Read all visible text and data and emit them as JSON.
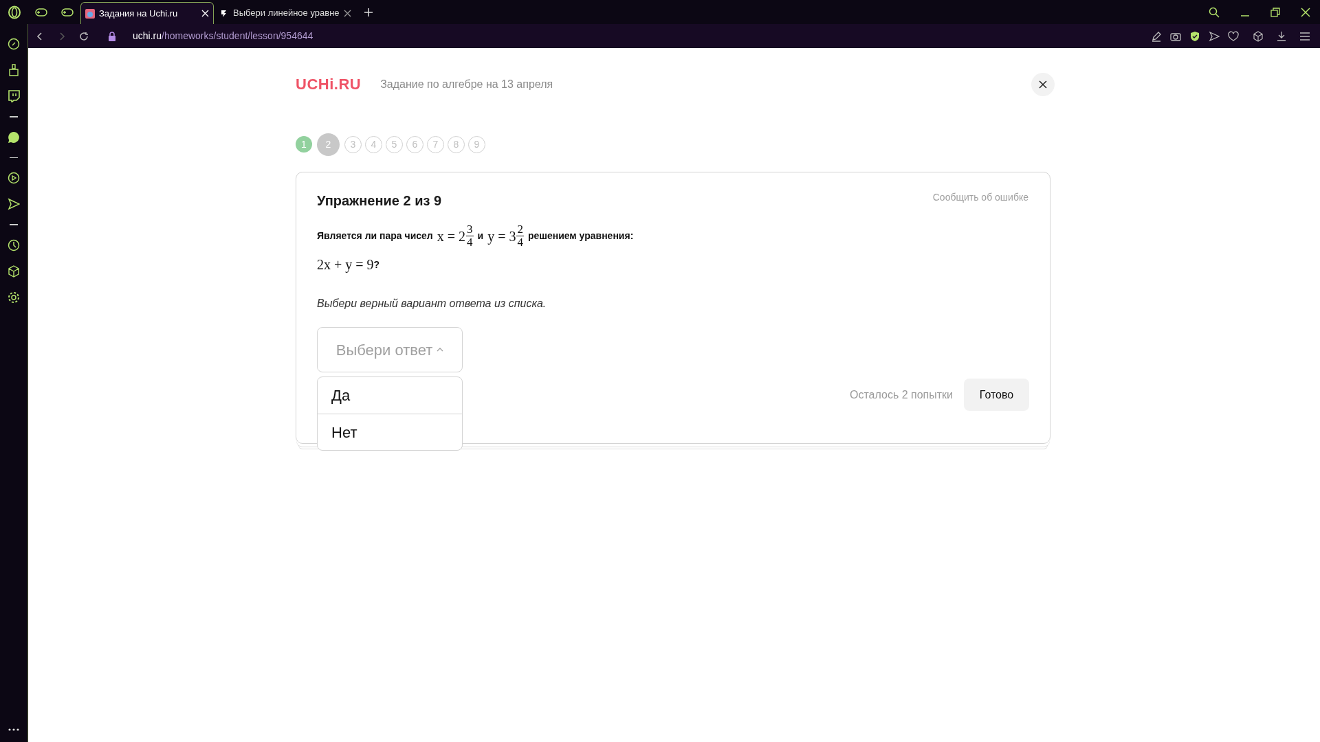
{
  "browser": {
    "tabs": [
      {
        "label": "Задания на Uchi.ru",
        "selected": true
      },
      {
        "label": "Выбери линейное уравне",
        "selected": false
      }
    ],
    "address": {
      "host": "uchi.ru",
      "path": "/homeworks/student/lesson/954644"
    }
  },
  "header": {
    "logo": "UCHi.RU",
    "title": "Задание по алгебре на 13 апреля"
  },
  "steps": [
    {
      "label": "1",
      "completed": true,
      "selected": false
    },
    {
      "label": "2",
      "completed": false,
      "selected": true
    },
    {
      "label": "3",
      "completed": false,
      "selected": false
    },
    {
      "label": "4",
      "completed": false,
      "selected": false
    },
    {
      "label": "5",
      "completed": false,
      "selected": false
    },
    {
      "label": "6",
      "completed": false,
      "selected": false
    },
    {
      "label": "7",
      "completed": false,
      "selected": false
    },
    {
      "label": "8",
      "completed": false,
      "selected": false
    },
    {
      "label": "9",
      "completed": false,
      "selected": false
    }
  ],
  "exercise": {
    "title": "Упражнение 2 из 9",
    "report_link": "Сообщить об ошибке",
    "question": [
      {
        "kind": "text",
        "text": "Является ли пара чисел"
      },
      {
        "kind": "math",
        "text": "x = 2"
      },
      {
        "kind": "fraction",
        "numerator": "3",
        "denominator": "4"
      },
      {
        "kind": "text",
        "text": "и"
      },
      {
        "kind": "math",
        "text": "y = 3"
      },
      {
        "kind": "fraction",
        "numerator": "2",
        "denominator": "4"
      },
      {
        "kind": "text",
        "text": "решением уравнения:"
      }
    ],
    "equation": [
      {
        "kind": "math",
        "text": "2x + y = 9"
      },
      {
        "kind": "text",
        "text": "?"
      }
    ],
    "instruction": "Выбери верный вариант ответа из списка.",
    "dropdown": {
      "placeholder": "Выбери ответ",
      "expanded": true,
      "options": [
        "Да",
        "Нет"
      ]
    },
    "attempts": "Осталось 2 попытки",
    "submit": "Готово"
  }
}
